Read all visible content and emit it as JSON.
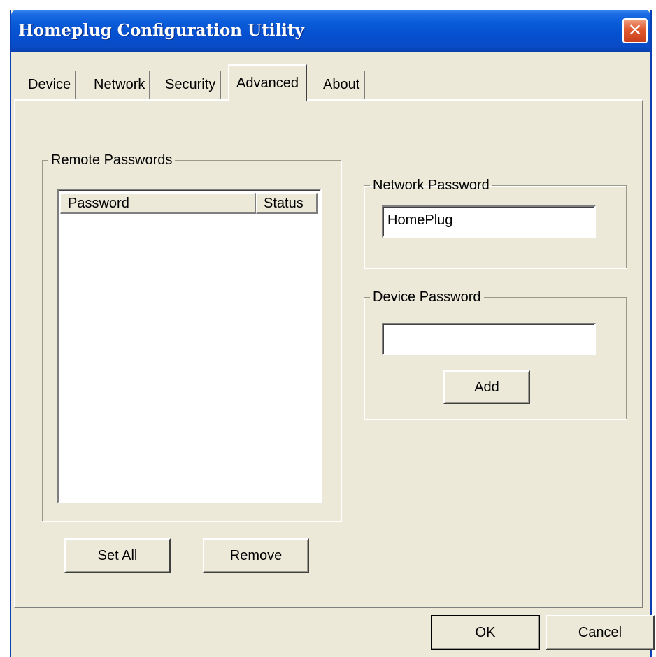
{
  "window": {
    "title": "Homeplug Configuration Utility",
    "close_glyph": "✕"
  },
  "tabs": [
    {
      "label": "Device"
    },
    {
      "label": "Network"
    },
    {
      "label": "Security"
    },
    {
      "label": "Advanced"
    },
    {
      "label": "About"
    }
  ],
  "active_tab": "Advanced",
  "remote_passwords": {
    "legend": "Remote Passwords",
    "columns": [
      "Password",
      "Status"
    ],
    "rows": []
  },
  "network_password": {
    "legend": "Network Password",
    "value": "HomePlug"
  },
  "device_password": {
    "legend": "Device Password",
    "value": "",
    "add_label": "Add"
  },
  "buttons": {
    "set_all": "Set All",
    "remove": "Remove",
    "ok": "OK",
    "cancel": "Cancel"
  },
  "colors": {
    "title_bar": "#0a5cd8",
    "face": "#ece9d8",
    "close_button": "#e05a30"
  }
}
